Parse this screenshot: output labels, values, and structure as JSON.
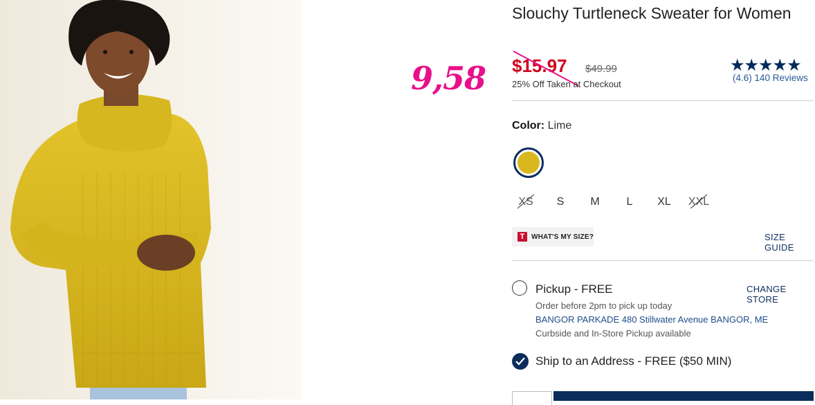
{
  "product": {
    "title": "Slouchy Turtleneck Sweater for Women",
    "sale_price": "$15.97",
    "original_price": "$49.99",
    "promo": "25% Off Taken at Checkout",
    "rating_stars": "★★★★★",
    "rating_value": 4.6,
    "reviews_text": "(4.6) 140 Reviews"
  },
  "annotation": {
    "text": "9,58",
    "color": "#e8108a"
  },
  "color": {
    "label": "Color:",
    "value": "Lime",
    "swatch_color": "#d8b81e"
  },
  "sizes": [
    {
      "label": "XS",
      "available": false
    },
    {
      "label": "S",
      "available": true
    },
    {
      "label": "M",
      "available": true
    },
    {
      "label": "L",
      "available": true
    },
    {
      "label": "XL",
      "available": true
    },
    {
      "label": "XXL",
      "available": false
    }
  ],
  "fit": {
    "logo_letter": "T",
    "label": "WHAT'S MY SIZE?",
    "size_guide": "SIZE GUIDE"
  },
  "pickup": {
    "label": "Pickup - FREE",
    "change_store": "CHANGE STORE",
    "note": "Order before 2pm to pick up today",
    "store": "BANGOR PARKADE 480 Stillwater Avenue  BANGOR, ME",
    "curbside": "Curbside and In-Store Pickup available",
    "selected": false
  },
  "shipping": {
    "label": "Ship to an Address - FREE ($50 MIN)",
    "selected": true
  },
  "colors": {
    "brand_navy": "#0b2d5c",
    "sale_red": "#d0021b",
    "annotation_pink": "#e8108a"
  }
}
